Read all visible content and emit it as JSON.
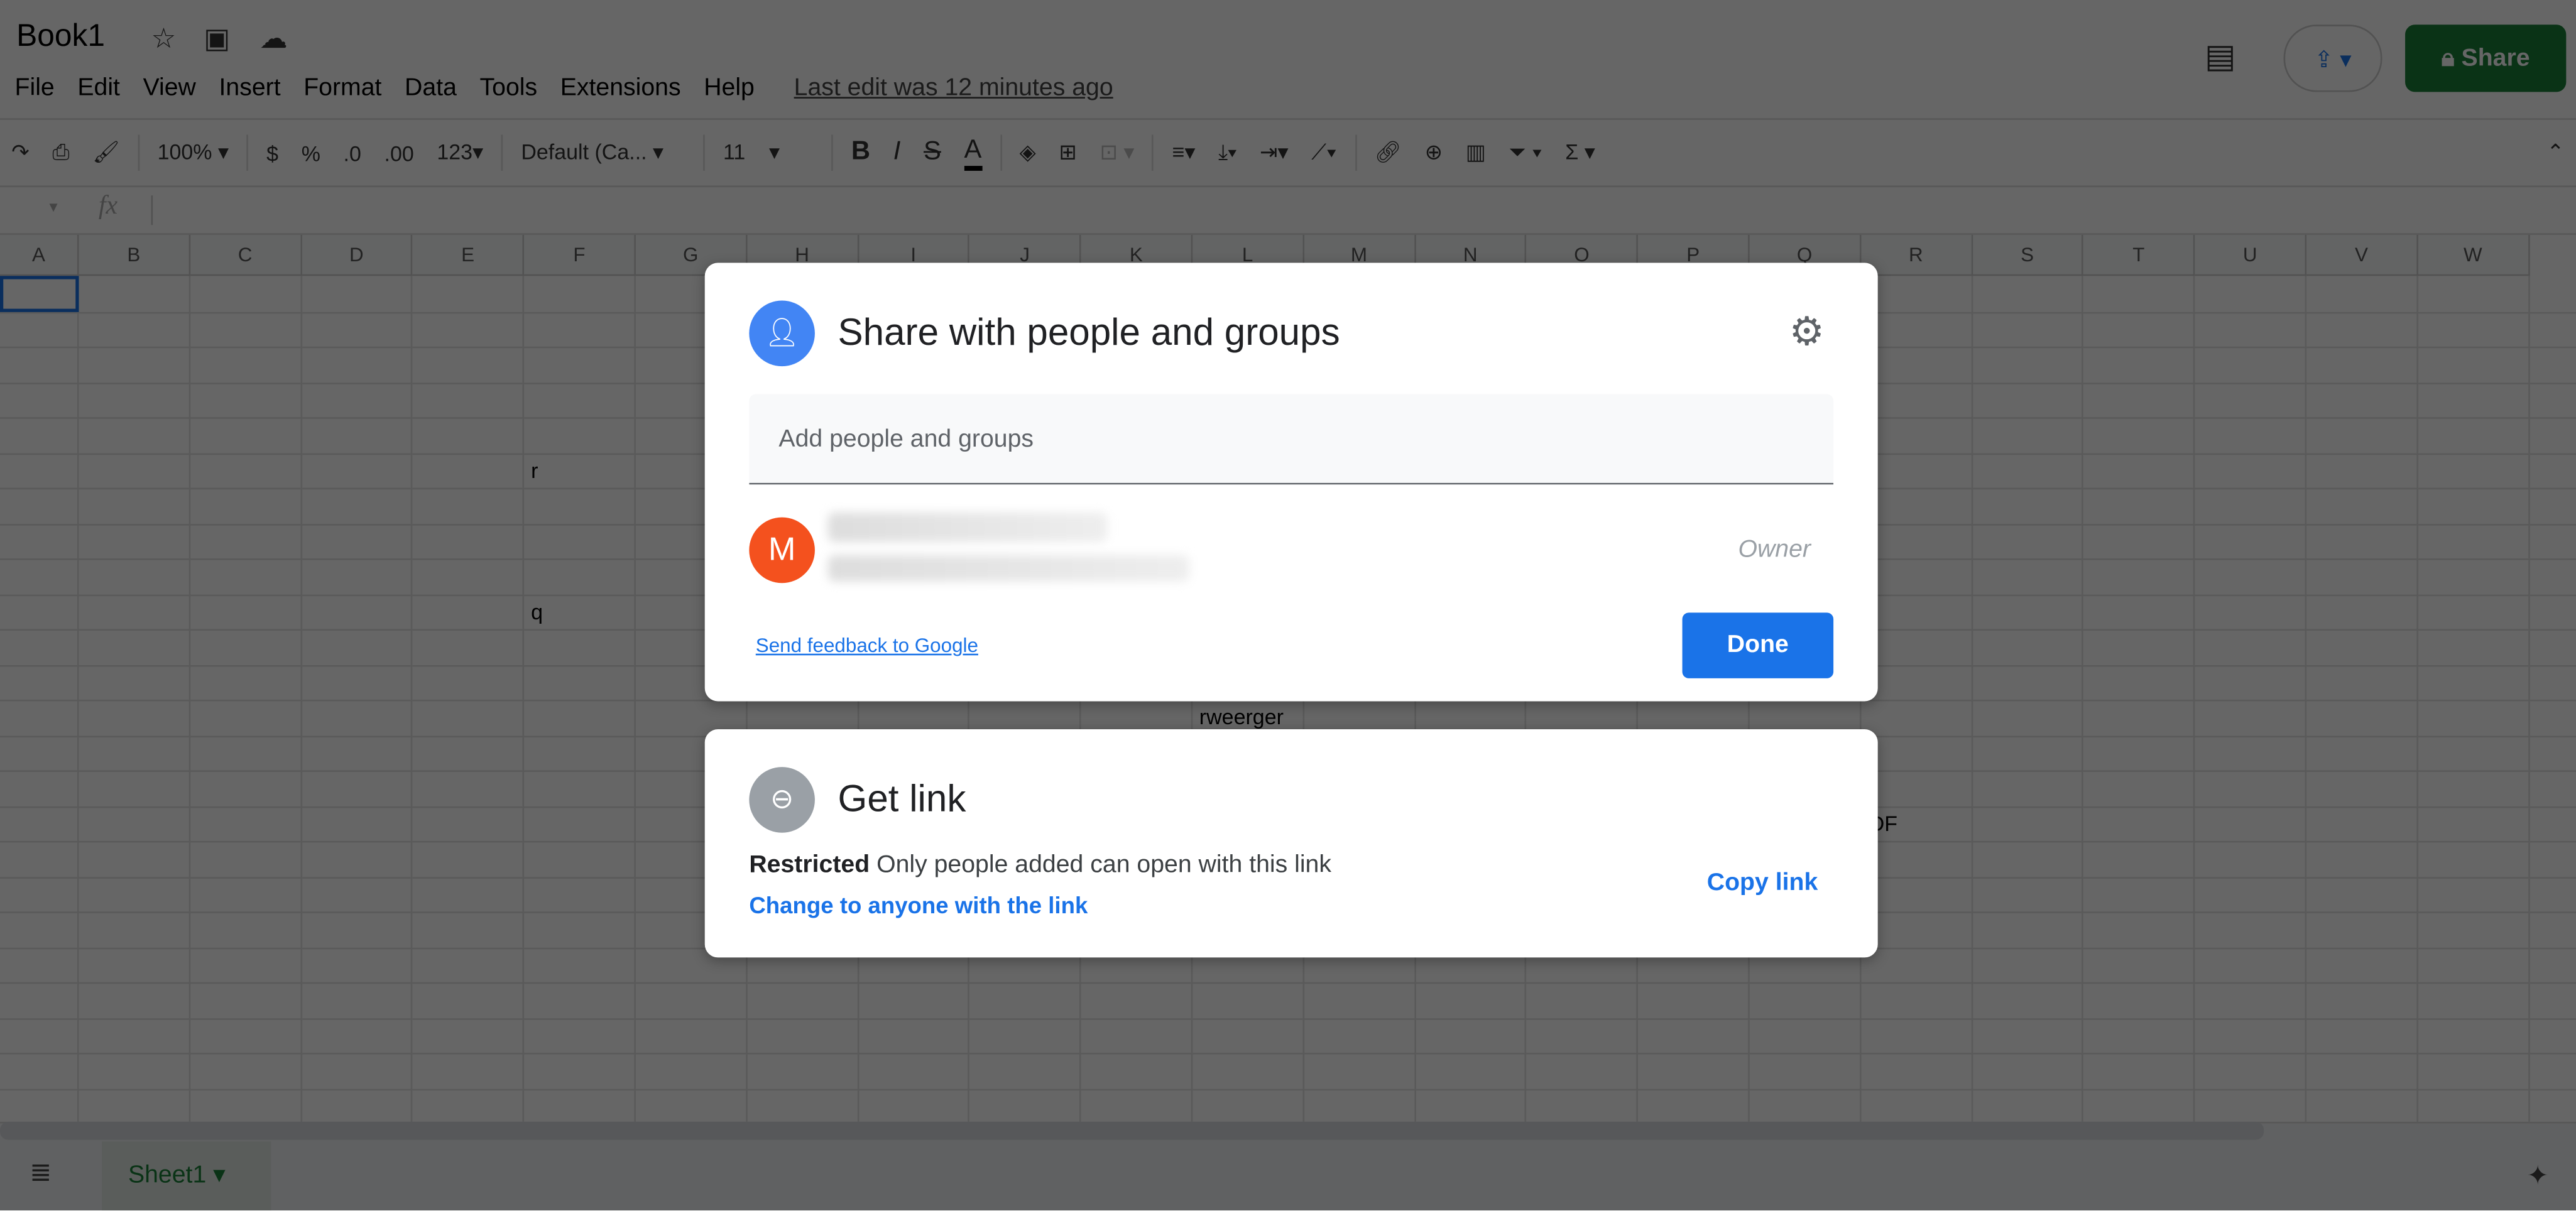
{
  "app": {
    "title": "Book1",
    "icons": [
      "star-icon",
      "move-folder-icon",
      "cloud-saved-icon"
    ]
  },
  "menu": [
    "File",
    "Edit",
    "View",
    "Insert",
    "Format",
    "Data",
    "Tools",
    "Extensions",
    "Help"
  ],
  "last_edit": "Last edit was 12 minutes ago",
  "header": {
    "share_label": "Share",
    "present_icon": "present-upload-icon",
    "comments_icon": "comment-icon"
  },
  "toolbar": {
    "zoom": "100%",
    "currency": "$",
    "percent": "%",
    "dec_less": ".0",
    "dec_more": ".00",
    "format_more": "123",
    "font": "Default (Ca...",
    "size": "11",
    "bold": "B",
    "italic": "I",
    "strike": "S",
    "text_color": "A",
    "sum": "Σ"
  },
  "formula": {
    "fx": "fx"
  },
  "grid": {
    "columns": [
      "A",
      "B",
      "C",
      "D",
      "E",
      "F",
      "G",
      "H",
      "I",
      "J",
      "K",
      "L",
      "M",
      "N",
      "O",
      "P",
      "Q",
      "R",
      "S",
      "T",
      "U",
      "V",
      "W"
    ],
    "cells": [
      {
        "col": 5,
        "row": 5,
        "text": "r"
      },
      {
        "col": 5,
        "row": 9,
        "text": "q"
      },
      {
        "col": 11,
        "row": 12,
        "text": "rweerger"
      },
      {
        "col": 16,
        "row": 15,
        "text": "DF"
      }
    ]
  },
  "sheets": [
    {
      "name": "Sheet1",
      "active": true
    }
  ],
  "share_dialog": {
    "title": "Share with people and groups",
    "input_placeholder": "Add people and groups",
    "owner": {
      "initial": "M",
      "role": "Owner",
      "avatar_color": "#f4511e"
    },
    "feedback_link": "Send feedback to Google",
    "done_label": "Done"
  },
  "link_dialog": {
    "title": "Get link",
    "restriction": "Restricted",
    "description": "Only people added can open with this link",
    "change_link": "Change to anyone with the link",
    "copy_link": "Copy link"
  },
  "colors": {
    "accent": "#1a73e8",
    "share_green": "#188038",
    "link_icon_bg": "#9aa0a6"
  }
}
